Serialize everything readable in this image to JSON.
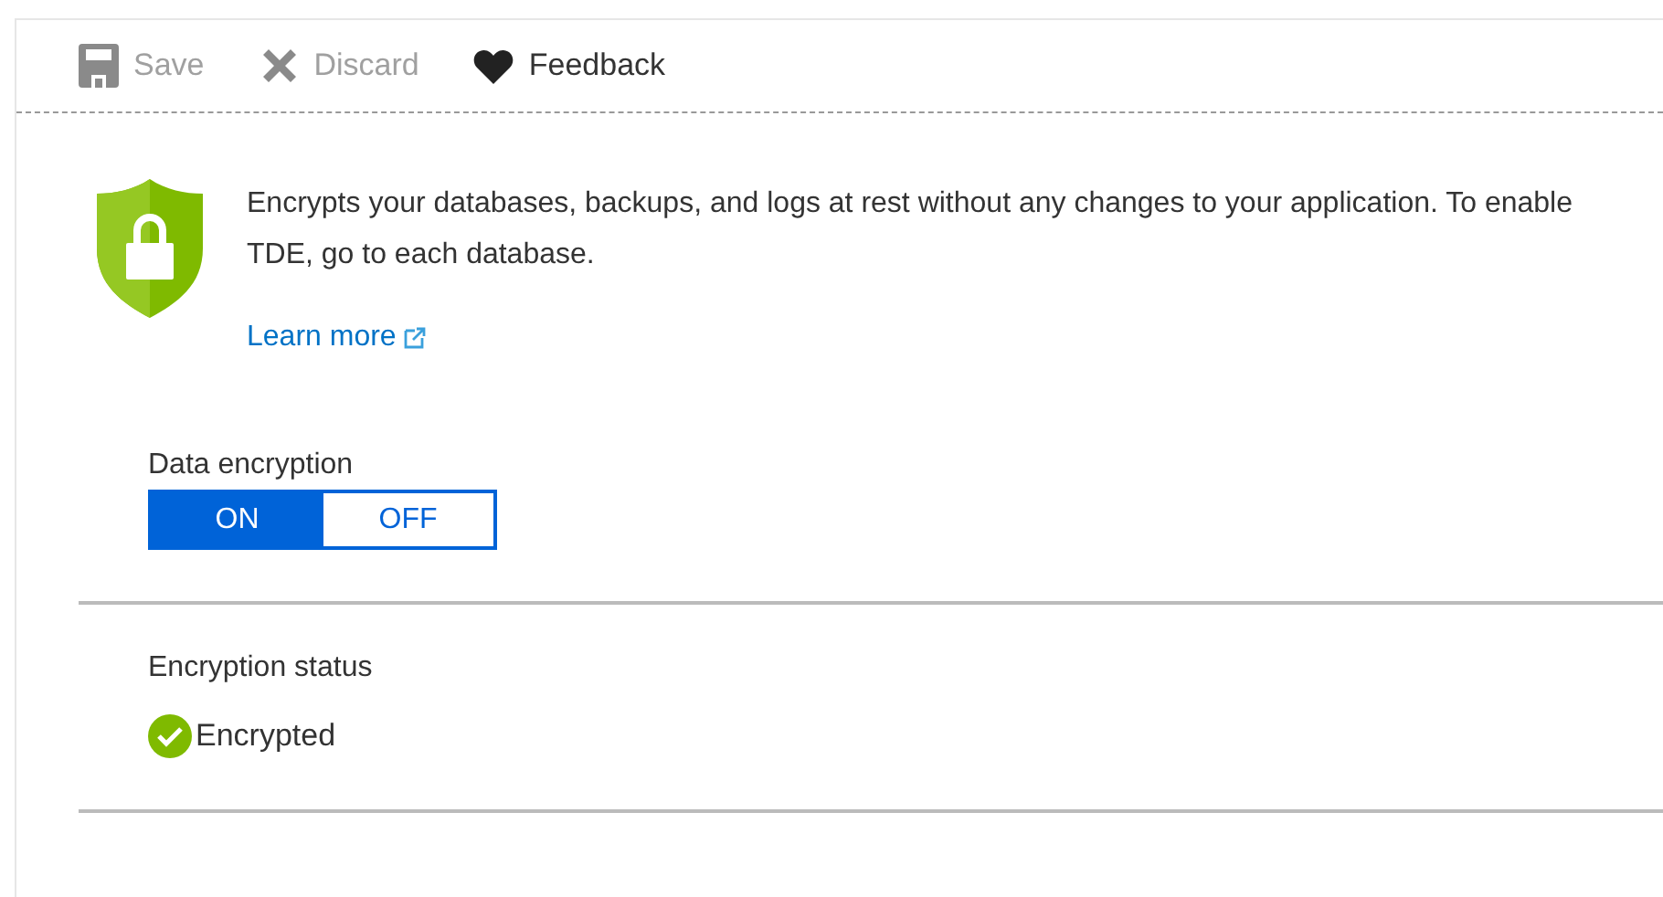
{
  "toolbar": [
    {
      "kind": "save",
      "label": "Save",
      "disabled": true
    },
    {
      "kind": "discard",
      "label": "Discard",
      "disabled": true
    },
    {
      "kind": "feedback",
      "label": "Feedback",
      "disabled": false
    }
  ],
  "description": "Encrypts your databases, backups, and logs at rest without any changes to your application. To enable TDE, go to each database.",
  "learn_more": "Learn more",
  "data_encryption": {
    "label": "Data encryption",
    "options": [
      {
        "label": "ON",
        "selected": true
      },
      {
        "label": "OFF",
        "selected": false
      }
    ]
  },
  "encryption_status": {
    "label": "Encryption status",
    "value": "Encrypted"
  }
}
